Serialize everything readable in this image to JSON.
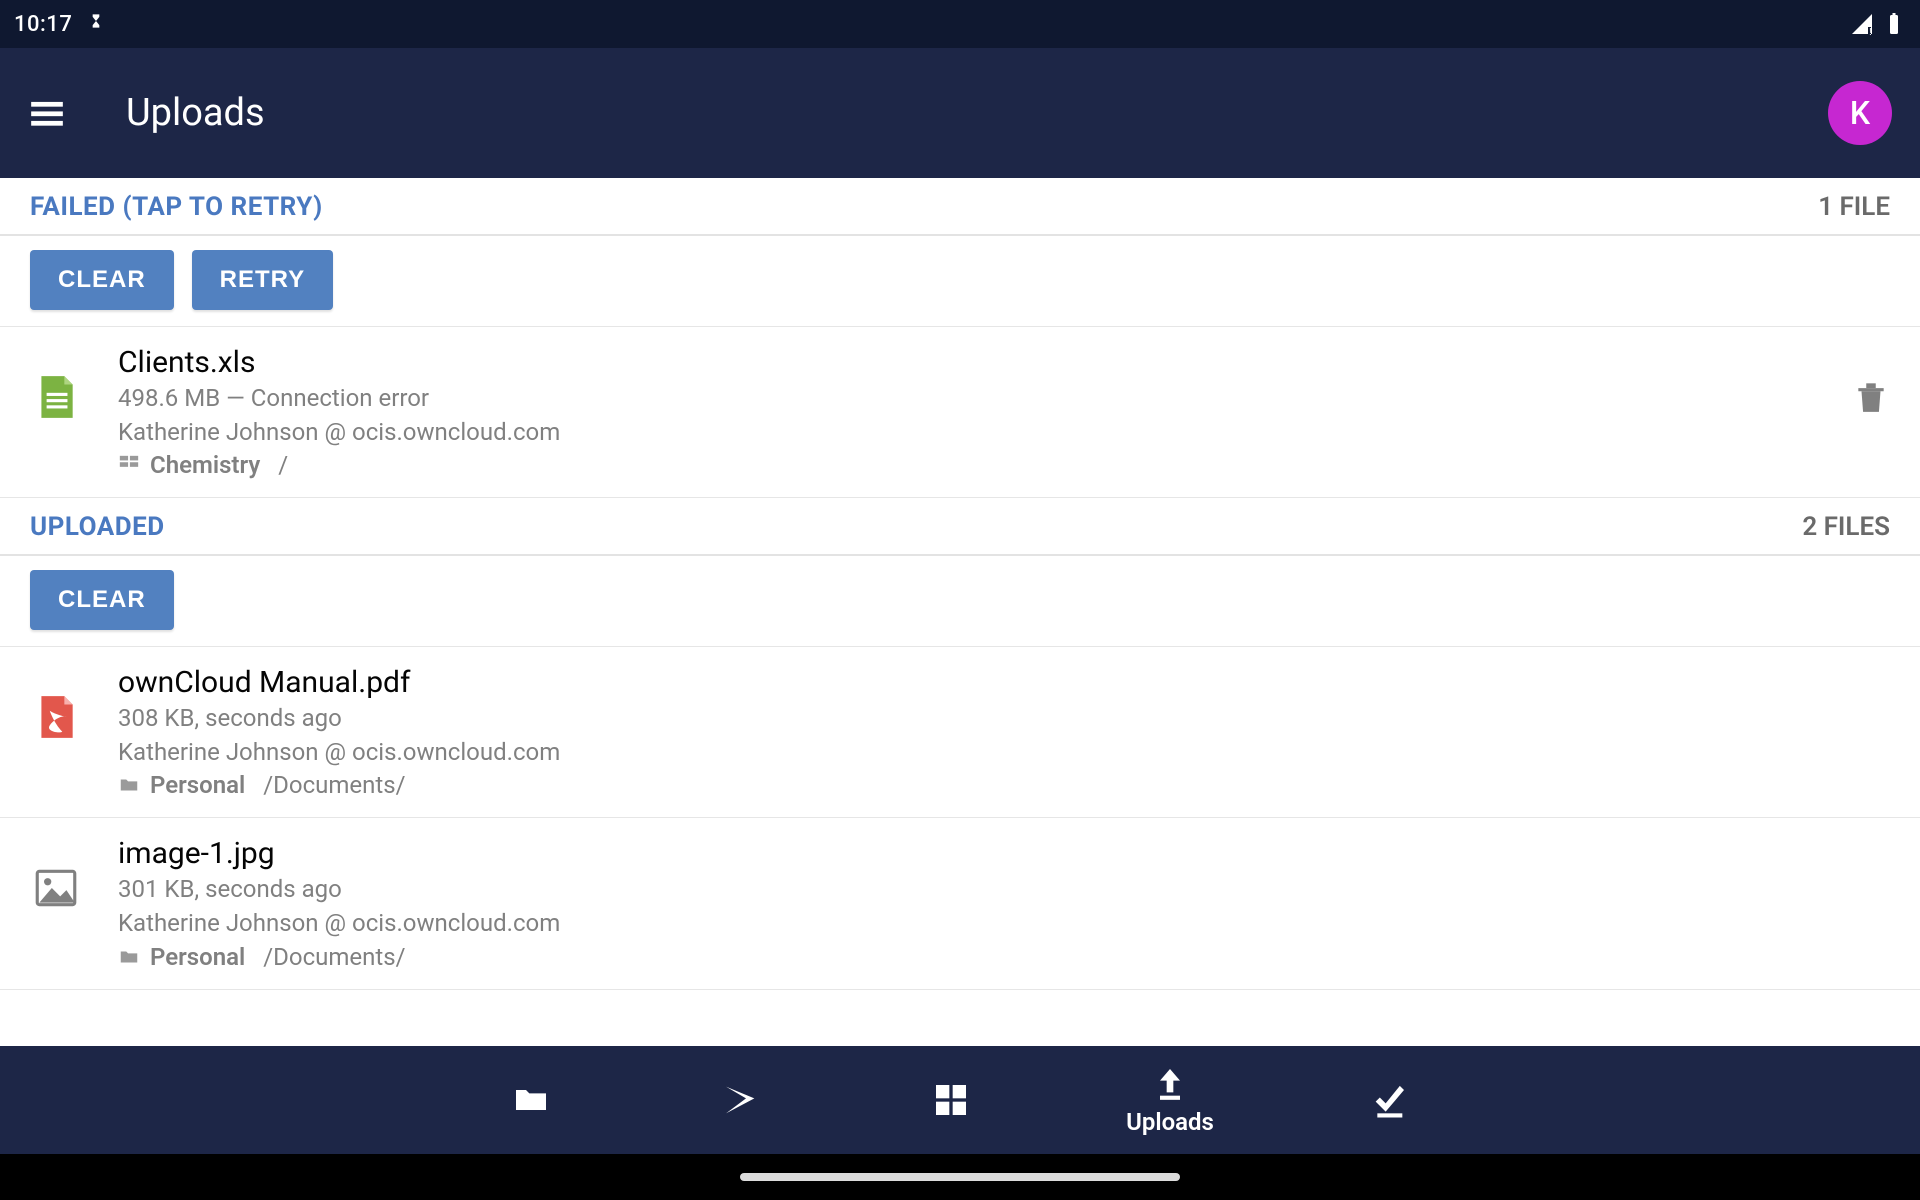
{
  "statusbar": {
    "time": "10:17"
  },
  "appbar": {
    "title": "Uploads"
  },
  "avatar": {
    "initial": "K"
  },
  "failed": {
    "header": "FAILED (TAP TO RETRY)",
    "count": "1 FILE",
    "buttons": {
      "clear": "CLEAR",
      "retry": "RETRY"
    },
    "items": [
      {
        "name": "Clients.xls",
        "sub": "498.6 MB — Connection error",
        "account": "Katherine Johnson @ ocis.owncloud.com",
        "space": "Chemistry",
        "path": "/"
      }
    ]
  },
  "uploaded": {
    "header": "UPLOADED",
    "count": "2 FILES",
    "buttons": {
      "clear": "CLEAR"
    },
    "items": [
      {
        "name": "ownCloud Manual.pdf",
        "sub": "308 KB, seconds ago",
        "account": "Katherine Johnson @ ocis.owncloud.com",
        "space": "Personal",
        "path": "/Documents/"
      },
      {
        "name": "image-1.jpg",
        "sub": "301 KB, seconds ago",
        "account": "Katherine Johnson @ ocis.owncloud.com",
        "space": "Personal",
        "path": "/Documents/"
      }
    ]
  },
  "bottomnav": {
    "active_label": "Uploads"
  }
}
